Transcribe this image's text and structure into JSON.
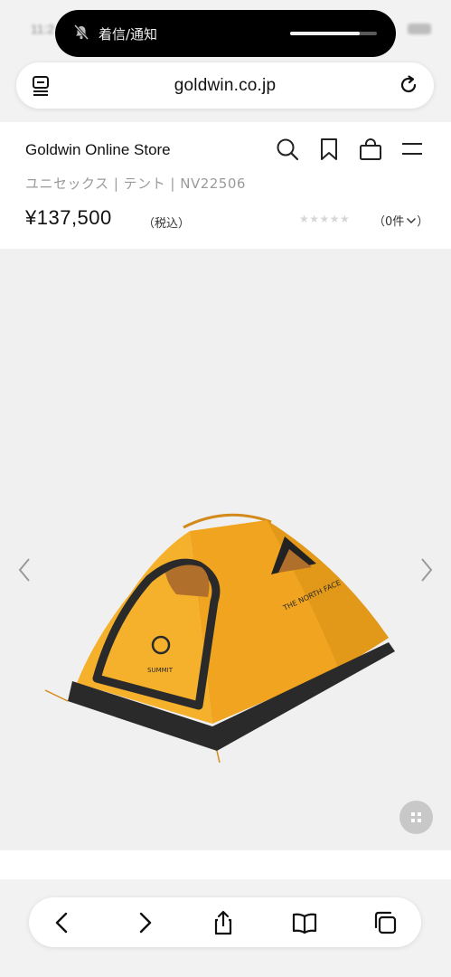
{
  "status_bar": {
    "notification_title": "着信/通知",
    "notification_level": 0.8
  },
  "browser": {
    "url": "goldwin.co.jp"
  },
  "store": {
    "name": "Goldwin Online Store",
    "breadcrumb": "ユニセックス | テント | NV22506",
    "price": "¥137,500",
    "tax_label": "（税込）",
    "rating_stars": "★★★★★",
    "rating_value": 0,
    "reviews_label": "（0件",
    "accent_color": "#f0a420"
  },
  "icons": [
    "bell-slash-icon",
    "tab-menu-icon",
    "reload-icon",
    "search-icon",
    "bookmark-icon",
    "cart-icon",
    "hamburger-icon",
    "chevron-left-icon",
    "chevron-right-icon",
    "grid-icon",
    "back-icon",
    "forward-icon",
    "share-icon",
    "bookmarks-book-icon",
    "tabs-icon"
  ]
}
